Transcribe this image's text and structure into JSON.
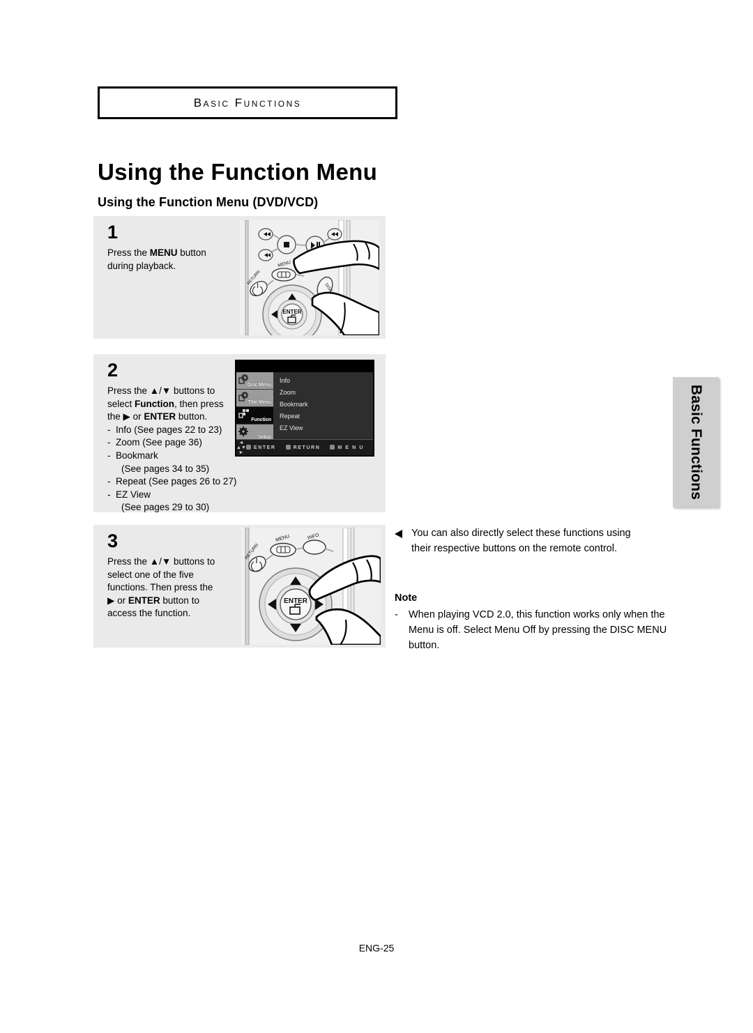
{
  "chapter": {
    "label": "Basic Functions"
  },
  "titles": {
    "main": "Using the Function Menu",
    "sub": "Using the Function Menu (DVD/VCD)"
  },
  "steps": [
    {
      "number": "1",
      "line1_pre": "Press the ",
      "line1_bold": "MENU",
      "line1_post": " button",
      "line2": "during playback.",
      "illustration": "remote-control-menu-button"
    },
    {
      "number": "2",
      "line1": "Press the ▲/▼ buttons to",
      "line2_pre": "select ",
      "line2_bold": "Function",
      "line2_post": ", then press",
      "line3_pre": "the ▶ or ",
      "line3_bold": "ENTER",
      "line3_post": " button.",
      "items": [
        {
          "dash": "-",
          "text": "Info (See pages 22 to 23)",
          "cont": ""
        },
        {
          "dash": "-",
          "text": "Zoom (See page 36)",
          "cont": ""
        },
        {
          "dash": "-",
          "text": "Bookmark",
          "cont": "(See pages 34 to 35)"
        },
        {
          "dash": "-",
          "text": "Repeat (See pages 26 to 27)",
          "cont": ""
        },
        {
          "dash": "-",
          "text": "EZ View",
          "cont": "(See pages 29 to 30)"
        }
      ]
    },
    {
      "number": "3",
      "line1": "Press the ▲/▼ buttons to",
      "line2": "select one of the five",
      "line3": "functions. Then press the",
      "line4_pre": "▶ or ",
      "line4_bold": "ENTER",
      "line4_post": " button to",
      "line5": "access the function.",
      "illustration": "remote-control-navigation-pad"
    }
  ],
  "osd": {
    "sidebar": [
      {
        "label": "Disc Menu",
        "icon": "disc-menu-icon",
        "selected": false
      },
      {
        "label": "Title Menu",
        "icon": "title-menu-icon",
        "selected": false
      },
      {
        "label": "Function",
        "icon": "function-icon",
        "selected": true
      },
      {
        "label": "Setup",
        "icon": "gear-icon",
        "selected": false
      }
    ],
    "menu_items": [
      "Info",
      "Zoom",
      "Bookmark",
      "Repeat",
      "EZ View"
    ],
    "bottom_bar": {
      "navpad": "◄ ▲▼ ►",
      "hints": [
        "ENTER",
        "RETURN",
        "M E N U"
      ]
    }
  },
  "right_column": {
    "tip": "You can also directly select these functions using their respective buttons on the remote control.",
    "note_heading": "Note",
    "note_dash": "-",
    "note_text": "When playing VCD 2.0, this function works only when the Menu is off. Select Menu Off by pressing the DISC MENU button."
  },
  "side_tab": {
    "label": "Basic Functions"
  },
  "footer": {
    "page": "ENG-25"
  },
  "colors": {
    "panel_bg": "#eaeaea",
    "illustration_bg": "#f0f0f0",
    "osd_bg": "#2e2e2e",
    "osd_selected": "#0a0a0a",
    "side_tab_bg": "#cfcfcf"
  }
}
